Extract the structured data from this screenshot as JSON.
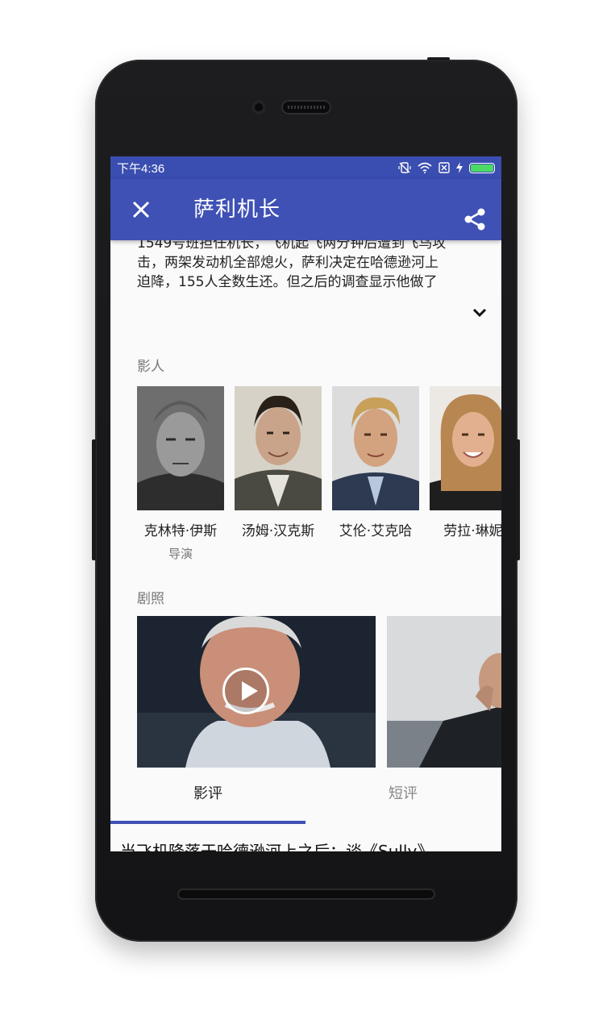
{
  "status_bar": {
    "time": "下午4:36",
    "icons": [
      "vibrate-off-icon",
      "wifi-icon",
      "no-sim-icon",
      "charging-icon",
      "battery-icon"
    ],
    "battery_level": 1.0,
    "battery_color": "#4cd964"
  },
  "app_bar": {
    "title": "萨利机长",
    "close_icon": "close-icon",
    "share_icon": "share-icon",
    "color": "#3f51b5"
  },
  "summary": {
    "lines": [
      "1549号班担任机长，飞机起飞两分钟后遭到飞鸟攻",
      "击，两架发动机全部熄火，萨利决定在哈德逊河上",
      "迫降，155人全数生还。但之后的调查显示他做了"
    ],
    "expand_icon": "chevron-down-icon"
  },
  "cast": {
    "title": "影人",
    "people": [
      {
        "name": "克林特·伊斯",
        "role": "导演"
      },
      {
        "name": "汤姆·汉克斯",
        "role": ""
      },
      {
        "name": "艾伦·艾克哈",
        "role": ""
      },
      {
        "name": "劳拉·琳妮",
        "role": ""
      }
    ]
  },
  "stills": {
    "title": "剧照",
    "play_icon": "play-icon"
  },
  "tabs": {
    "items": [
      {
        "label": "影评"
      },
      {
        "label": "短评"
      }
    ],
    "active_index": 0
  },
  "review": {
    "first_title": "当飞机降落于哈德逊河上之后：谈《Sully》"
  }
}
